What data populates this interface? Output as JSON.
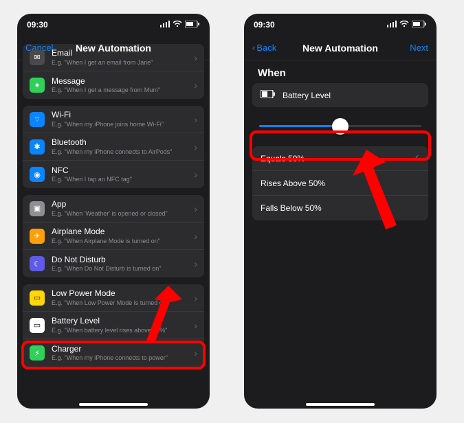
{
  "statusbar": {
    "time": "09:30"
  },
  "left": {
    "cancel": "Cancel",
    "title": "New Automation",
    "groups": [
      {
        "items": [
          {
            "icon": "email-icon",
            "bg": "#4a4a4c",
            "glyph": "✉︎",
            "title": "Email",
            "sub": "E.g. \"When I get an email from Jane\""
          },
          {
            "icon": "message-icon",
            "bg": "#30d158",
            "glyph": "●",
            "title": "Message",
            "sub": "E.g. \"When I get a message from Mum\""
          }
        ]
      },
      {
        "items": [
          {
            "icon": "wifi-icon",
            "bg": "#0a84ff",
            "glyph": "⌔",
            "title": "Wi-Fi",
            "sub": "E.g. \"When my iPhone joins home Wi-Fi\""
          },
          {
            "icon": "bluetooth-icon",
            "bg": "#0a84ff",
            "glyph": "✱",
            "title": "Bluetooth",
            "sub": "E.g. \"When my iPhone connects to AirPods\""
          },
          {
            "icon": "nfc-icon",
            "bg": "#0a84ff",
            "glyph": "◉",
            "title": "NFC",
            "sub": "E.g. \"When I tap an NFC tag\""
          }
        ]
      },
      {
        "items": [
          {
            "icon": "app-icon",
            "bg": "#8e8e93",
            "glyph": "▣",
            "title": "App",
            "sub": "E.g. \"When 'Weather' is opened or closed\""
          },
          {
            "icon": "airplane-icon",
            "bg": "#ff9f0a",
            "glyph": "✈︎",
            "title": "Airplane Mode",
            "sub": "E.g. \"When Airplane Mode is turned on\""
          },
          {
            "icon": "dnd-icon",
            "bg": "#5e5ce6",
            "glyph": "☾",
            "title": "Do Not Disturb",
            "sub": "E.g. \"When Do Not Disturb is turned on\""
          }
        ]
      },
      {
        "items": [
          {
            "icon": "lowpower-icon",
            "bg": "#ffd60a",
            "glyph": "▭",
            "title": "Low Power Mode",
            "sub": "E.g. \"When Low Power Mode is turned off\""
          },
          {
            "icon": "battery-icon",
            "bg": "#ffffff",
            "glyph": "▭",
            "title": "Battery Level",
            "sub": "E.g. \"When battery level rises above 50%\""
          },
          {
            "icon": "charger-icon",
            "bg": "#30d158",
            "glyph": "⚡︎",
            "title": "Charger",
            "sub": "E.g. \"When my iPhone connects to power\""
          }
        ]
      }
    ]
  },
  "right": {
    "back": "Back",
    "title": "New Automation",
    "next": "Next",
    "when_label": "When",
    "trigger_label": "Battery Level",
    "slider_percent": 50,
    "options": [
      {
        "label": "Equals 50%",
        "selected": true
      },
      {
        "label": "Rises Above 50%",
        "selected": false
      },
      {
        "label": "Falls Below 50%",
        "selected": false
      }
    ]
  },
  "colors": {
    "accent": "#0a84ff",
    "highlight": "#ff0000"
  }
}
